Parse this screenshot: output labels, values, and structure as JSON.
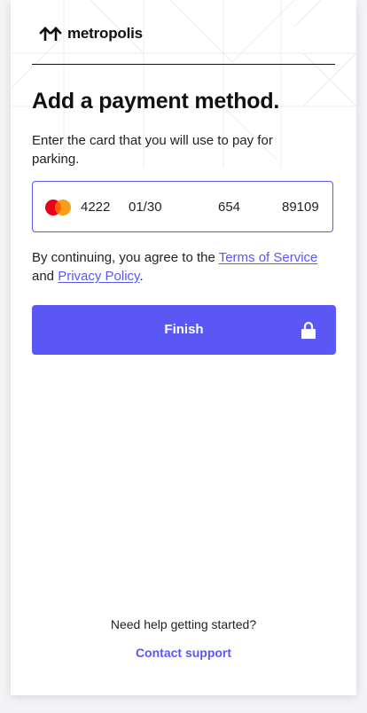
{
  "brand": {
    "name": "metropolis",
    "logo_icon": "metropolis-logo-icon"
  },
  "page": {
    "title": "Add a payment method.",
    "subtitle": "Enter the card that you will use to pay for parking."
  },
  "card_form": {
    "brand_icon": "mastercard-icon",
    "card_number": "4222",
    "expiry": "01/30",
    "cvc": "654",
    "zip": "89109"
  },
  "terms": {
    "prefix": "By continuing, you agree to the ",
    "terms_link": "Terms of Service",
    "middle": " and ",
    "privacy_link": "Privacy Policy",
    "suffix": "."
  },
  "actions": {
    "finish_label": "Finish",
    "finish_icon": "lock-icon"
  },
  "help": {
    "question": "Need help getting started?",
    "support_link": "Contact support"
  },
  "colors": {
    "accent": "#5b57f5",
    "text": "#111111",
    "mastercard_red": "#eb001b",
    "mastercard_orange": "#f79e1b"
  }
}
